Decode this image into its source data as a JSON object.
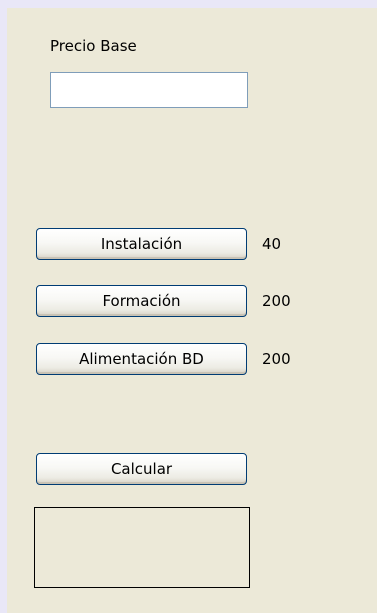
{
  "form": {
    "precio_base_label": "Precio Base",
    "precio_base_value": "",
    "options": [
      {
        "label": "Instalación",
        "value": "40"
      },
      {
        "label": "Formación",
        "value": "200"
      },
      {
        "label": "Alimentación BD",
        "value": "200"
      }
    ],
    "calcular_label": "Calcular",
    "result_text": ""
  },
  "colors": {
    "window_background": "#ece9d8",
    "outer_border": "#e9e7f7",
    "button_border": "#003c74",
    "field_border": "#7f9db9"
  }
}
